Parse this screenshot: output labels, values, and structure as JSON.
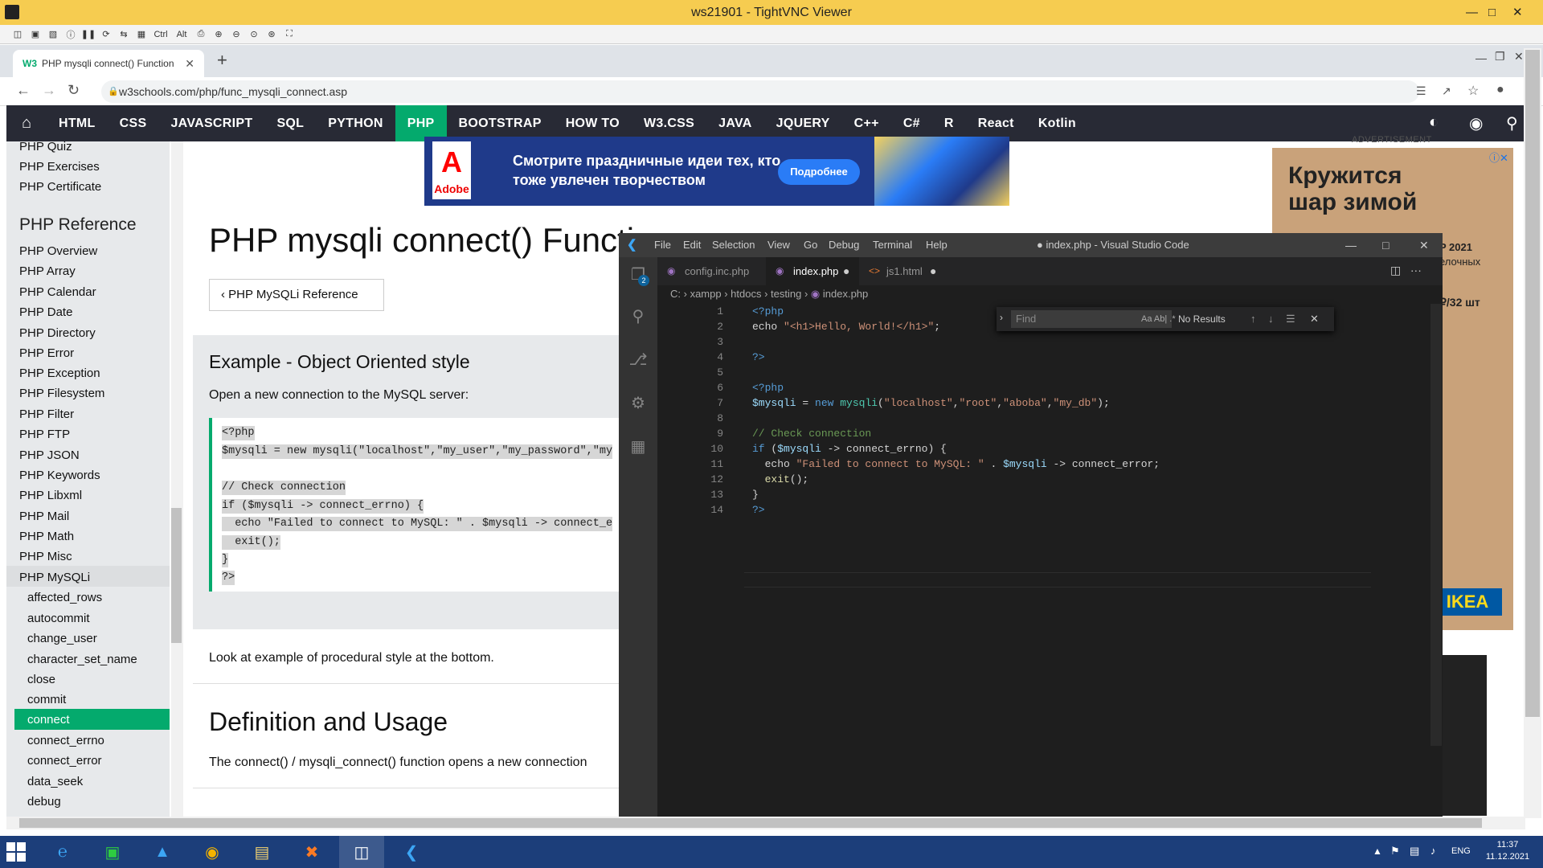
{
  "vnc": {
    "title": "ws21901 - TightVNC Viewer",
    "toolbar_icons": [
      "new-conn-icon",
      "save-icon",
      "options-icon",
      "info-icon",
      "pause-icon",
      "refresh-icon",
      "transfer-icon",
      "ctrl-alt-del-icon",
      "ctrl-label",
      "alt-label",
      "clipboard-icon",
      "zoom-in-icon",
      "zoom-out-icon",
      "zoom-100-icon",
      "zoom-fit-icon",
      "fullscreen-icon"
    ],
    "ctrl": "Ctrl",
    "alt": "Alt"
  },
  "browser": {
    "tab_title": "PHP mysqli connect() Function",
    "url": "w3schools.com/php/func_mysqli_connect.asp"
  },
  "w3nav": {
    "items": [
      "HTML",
      "CSS",
      "JAVASCRIPT",
      "SQL",
      "PYTHON",
      "PHP",
      "BOOTSTRAP",
      "HOW TO",
      "W3.CSS",
      "JAVA",
      "JQUERY",
      "C++",
      "C#",
      "R",
      "React",
      "Kotlin"
    ],
    "active": "PHP"
  },
  "sidebar": {
    "top": [
      "PHP Quiz",
      "PHP Exercises",
      "PHP Certificate"
    ],
    "ref_heading": "PHP Reference",
    "refs": [
      "PHP Overview",
      "PHP Array",
      "PHP Calendar",
      "PHP Date",
      "PHP Directory",
      "PHP Error",
      "PHP Exception",
      "PHP Filesystem",
      "PHP Filter",
      "PHP FTP",
      "PHP JSON",
      "PHP Keywords",
      "PHP Libxml",
      "PHP Mail",
      "PHP Math",
      "PHP Misc",
      "PHP MySQLi"
    ],
    "subs": [
      "affected_rows",
      "autocommit",
      "change_user",
      "character_set_name",
      "close",
      "commit",
      "connect",
      "connect_errno",
      "connect_error",
      "data_seek",
      "debug"
    ],
    "active": "connect"
  },
  "ad_top": {
    "logo": "A",
    "logo_sub": "Adobe",
    "text": "Смотрите праздничные идеи тех, кто тоже увлечен творчеством",
    "button": "Подробнее"
  },
  "content": {
    "title": "PHP mysqli connect() Functi",
    "ref_button": "PHP MySQLi Reference",
    "example_title": "Example - Object Oriented style",
    "example_sub": "Open a new connection to the MySQL server:",
    "code": [
      "<?php",
      "$mysqli = new mysqli(\"localhost\",\"my_user\",\"my_password\",\"my",
      "",
      "// Check connection",
      "if ($mysqli -> connect_errno) {",
      "  echo \"Failed to connect to MySQL: \" . $mysqli -> connect_e",
      "  exit();",
      "}",
      "?>"
    ],
    "look": "Look at example of procedural style at the bottom.",
    "def_title": "Definition and Usage",
    "def_text": "The connect() / mysqli_connect() function opens a new connection"
  },
  "ad_right": {
    "label": "ADVERTISEMENT",
    "title1": "Кружится",
    "title2": "шар зимой",
    "p1": "P 2021",
    "p2": "елочных",
    "p3": "₽/32 шт",
    "brand": "IKEA"
  },
  "vscode": {
    "title": "● index.php - Visual Studio Code",
    "menu": [
      "File",
      "Edit",
      "Selection",
      "View",
      "Go",
      "Debug",
      "Terminal",
      "Help"
    ],
    "tabs": [
      {
        "label": "config.inc.php",
        "active": false
      },
      {
        "label": "index.php",
        "active": true
      },
      {
        "label": "js1.html",
        "active": false
      }
    ],
    "badge": "2",
    "breadcrumb": [
      "C:",
      "xampp",
      "htdocs",
      "testing",
      "index.php"
    ],
    "find_placeholder": "Find",
    "find_opts": "Aa  Ab|  .*",
    "find_result": "No Results",
    "line_numbers": [
      "1",
      "2",
      "3",
      "4",
      "5",
      "6",
      "7",
      "8",
      "9",
      "10",
      "11",
      "12",
      "13",
      "14"
    ]
  },
  "taskbar": {
    "lang": "ENG",
    "time": "11:37",
    "date": "11.12.2021"
  },
  "colors": {
    "w3green": "#04aa6d",
    "w3dark": "#282a35",
    "vnc_title": "#f6cc50",
    "vscode_bg": "#1e1e1e",
    "taskbar": "#1c3e7a"
  }
}
